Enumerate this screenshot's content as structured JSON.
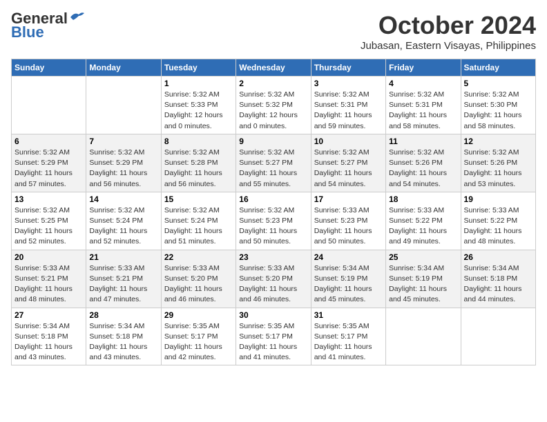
{
  "header": {
    "logo_line1": "General",
    "logo_line2": "Blue",
    "month_title": "October 2024",
    "location": "Jubasan, Eastern Visayas, Philippines"
  },
  "weekdays": [
    "Sunday",
    "Monday",
    "Tuesday",
    "Wednesday",
    "Thursday",
    "Friday",
    "Saturday"
  ],
  "weeks": [
    [
      {
        "day": "",
        "info": ""
      },
      {
        "day": "",
        "info": ""
      },
      {
        "day": "1",
        "info": "Sunrise: 5:32 AM\nSunset: 5:33 PM\nDaylight: 12 hours\nand 0 minutes."
      },
      {
        "day": "2",
        "info": "Sunrise: 5:32 AM\nSunset: 5:32 PM\nDaylight: 12 hours\nand 0 minutes."
      },
      {
        "day": "3",
        "info": "Sunrise: 5:32 AM\nSunset: 5:31 PM\nDaylight: 11 hours\nand 59 minutes."
      },
      {
        "day": "4",
        "info": "Sunrise: 5:32 AM\nSunset: 5:31 PM\nDaylight: 11 hours\nand 58 minutes."
      },
      {
        "day": "5",
        "info": "Sunrise: 5:32 AM\nSunset: 5:30 PM\nDaylight: 11 hours\nand 58 minutes."
      }
    ],
    [
      {
        "day": "6",
        "info": "Sunrise: 5:32 AM\nSunset: 5:29 PM\nDaylight: 11 hours\nand 57 minutes."
      },
      {
        "day": "7",
        "info": "Sunrise: 5:32 AM\nSunset: 5:29 PM\nDaylight: 11 hours\nand 56 minutes."
      },
      {
        "day": "8",
        "info": "Sunrise: 5:32 AM\nSunset: 5:28 PM\nDaylight: 11 hours\nand 56 minutes."
      },
      {
        "day": "9",
        "info": "Sunrise: 5:32 AM\nSunset: 5:27 PM\nDaylight: 11 hours\nand 55 minutes."
      },
      {
        "day": "10",
        "info": "Sunrise: 5:32 AM\nSunset: 5:27 PM\nDaylight: 11 hours\nand 54 minutes."
      },
      {
        "day": "11",
        "info": "Sunrise: 5:32 AM\nSunset: 5:26 PM\nDaylight: 11 hours\nand 54 minutes."
      },
      {
        "day": "12",
        "info": "Sunrise: 5:32 AM\nSunset: 5:26 PM\nDaylight: 11 hours\nand 53 minutes."
      }
    ],
    [
      {
        "day": "13",
        "info": "Sunrise: 5:32 AM\nSunset: 5:25 PM\nDaylight: 11 hours\nand 52 minutes."
      },
      {
        "day": "14",
        "info": "Sunrise: 5:32 AM\nSunset: 5:24 PM\nDaylight: 11 hours\nand 52 minutes."
      },
      {
        "day": "15",
        "info": "Sunrise: 5:32 AM\nSunset: 5:24 PM\nDaylight: 11 hours\nand 51 minutes."
      },
      {
        "day": "16",
        "info": "Sunrise: 5:32 AM\nSunset: 5:23 PM\nDaylight: 11 hours\nand 50 minutes."
      },
      {
        "day": "17",
        "info": "Sunrise: 5:33 AM\nSunset: 5:23 PM\nDaylight: 11 hours\nand 50 minutes."
      },
      {
        "day": "18",
        "info": "Sunrise: 5:33 AM\nSunset: 5:22 PM\nDaylight: 11 hours\nand 49 minutes."
      },
      {
        "day": "19",
        "info": "Sunrise: 5:33 AM\nSunset: 5:22 PM\nDaylight: 11 hours\nand 48 minutes."
      }
    ],
    [
      {
        "day": "20",
        "info": "Sunrise: 5:33 AM\nSunset: 5:21 PM\nDaylight: 11 hours\nand 48 minutes."
      },
      {
        "day": "21",
        "info": "Sunrise: 5:33 AM\nSunset: 5:21 PM\nDaylight: 11 hours\nand 47 minutes."
      },
      {
        "day": "22",
        "info": "Sunrise: 5:33 AM\nSunset: 5:20 PM\nDaylight: 11 hours\nand 46 minutes."
      },
      {
        "day": "23",
        "info": "Sunrise: 5:33 AM\nSunset: 5:20 PM\nDaylight: 11 hours\nand 46 minutes."
      },
      {
        "day": "24",
        "info": "Sunrise: 5:34 AM\nSunset: 5:19 PM\nDaylight: 11 hours\nand 45 minutes."
      },
      {
        "day": "25",
        "info": "Sunrise: 5:34 AM\nSunset: 5:19 PM\nDaylight: 11 hours\nand 45 minutes."
      },
      {
        "day": "26",
        "info": "Sunrise: 5:34 AM\nSunset: 5:18 PM\nDaylight: 11 hours\nand 44 minutes."
      }
    ],
    [
      {
        "day": "27",
        "info": "Sunrise: 5:34 AM\nSunset: 5:18 PM\nDaylight: 11 hours\nand 43 minutes."
      },
      {
        "day": "28",
        "info": "Sunrise: 5:34 AM\nSunset: 5:18 PM\nDaylight: 11 hours\nand 43 minutes."
      },
      {
        "day": "29",
        "info": "Sunrise: 5:35 AM\nSunset: 5:17 PM\nDaylight: 11 hours\nand 42 minutes."
      },
      {
        "day": "30",
        "info": "Sunrise: 5:35 AM\nSunset: 5:17 PM\nDaylight: 11 hours\nand 41 minutes."
      },
      {
        "day": "31",
        "info": "Sunrise: 5:35 AM\nSunset: 5:17 PM\nDaylight: 11 hours\nand 41 minutes."
      },
      {
        "day": "",
        "info": ""
      },
      {
        "day": "",
        "info": ""
      }
    ]
  ]
}
